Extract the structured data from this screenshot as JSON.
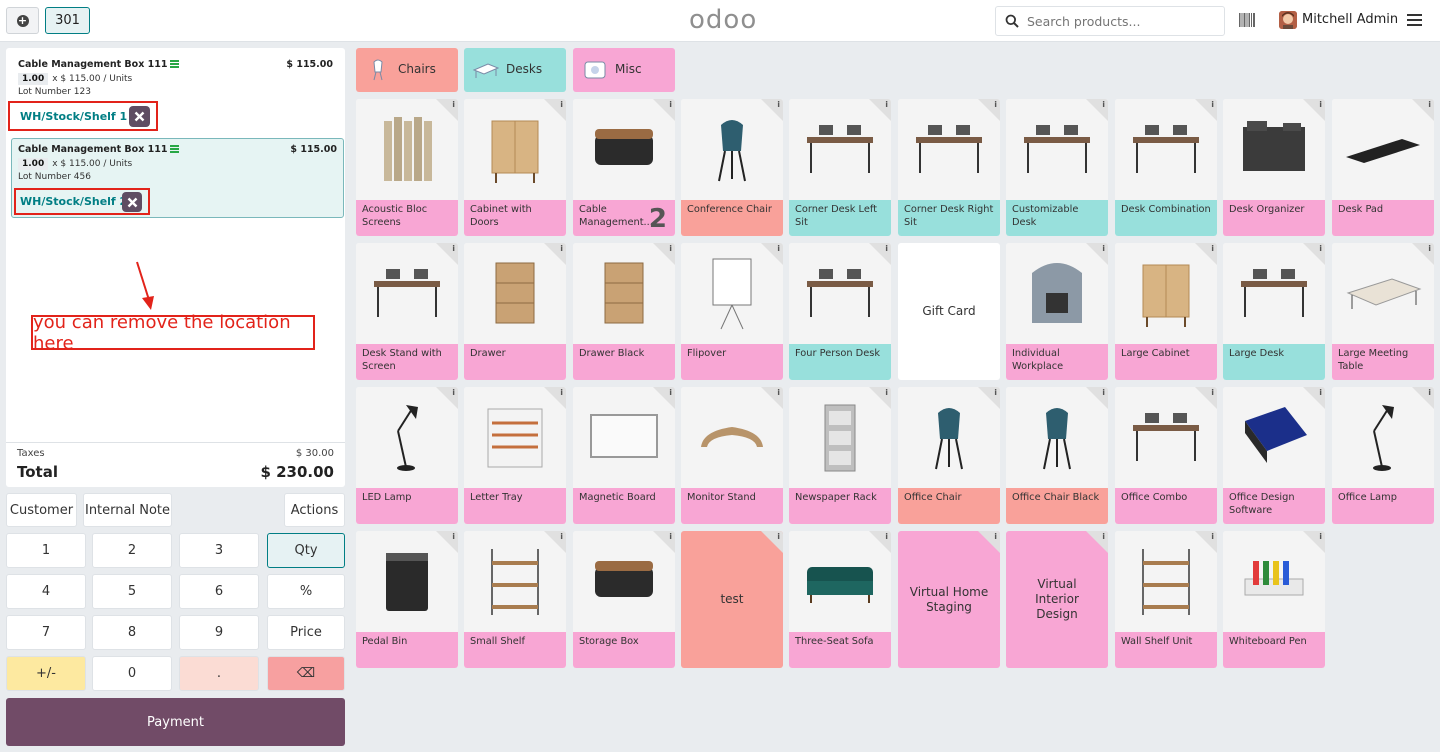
{
  "header": {
    "order_number": "301",
    "logo": "odoo",
    "search_placeholder": "Search products...",
    "user_name": "Mitchell Admin"
  },
  "order": {
    "lines": [
      {
        "name": "Cable Management Box 111",
        "price": "$ 115.00",
        "qty": "1.00",
        "unit_price": "x $ 115.00 / Units",
        "lot": "Lot Number 123",
        "location": "WH/Stock/Shelf 1",
        "selected": false
      },
      {
        "name": "Cable Management Box 111",
        "price": "$ 115.00",
        "qty": "1.00",
        "unit_price": "x $ 115.00 / Units",
        "lot": "Lot Number 456",
        "location": "WH/Stock/Shelf 2",
        "selected": true
      }
    ],
    "annotation": "you can remove the location here",
    "taxes_label": "Taxes",
    "taxes_value": "$ 30.00",
    "total_label": "Total",
    "total_value": "$ 230.00"
  },
  "controls": {
    "customer": "Customer",
    "internal_note": "Internal Note",
    "actions": "Actions"
  },
  "numpad": {
    "keys": [
      "1",
      "2",
      "3",
      "Qty",
      "4",
      "5",
      "6",
      "%",
      "7",
      "8",
      "9",
      "Price",
      "+/-",
      "0",
      ".",
      "⌫"
    ],
    "active": "Qty"
  },
  "payment_label": "Payment",
  "categories": [
    {
      "label": "Chairs",
      "color": "#f9a19a",
      "icon": "chair-icon"
    },
    {
      "label": "Desks",
      "color": "#98e0dc",
      "icon": "desk-icon"
    },
    {
      "label": "Misc",
      "color": "#f8a6d4",
      "icon": "misc-icon"
    }
  ],
  "colors": {
    "pink": "#f8a6d4",
    "salmon": "#f9a19a",
    "teal": "#98e0dc",
    "payment": "#714b67",
    "brand": "#017e84",
    "annotation_red": "#e2231a"
  },
  "products": [
    {
      "name": "Acoustic Bloc Screens",
      "color": "pink",
      "icon": "screen-icon"
    },
    {
      "name": "Cabinet with Doors",
      "color": "pink",
      "icon": "cabinet-icon"
    },
    {
      "name": "Cable Management...",
      "color": "pink",
      "icon": "box-icon",
      "badge": "2"
    },
    {
      "name": "Conference Chair",
      "color": "salmon",
      "icon": "chair-icon"
    },
    {
      "name": "Corner Desk Left Sit",
      "color": "teal",
      "icon": "desk-icon"
    },
    {
      "name": "Corner Desk Right Sit",
      "color": "teal",
      "icon": "desk-icon"
    },
    {
      "name": "Customizable Desk",
      "color": "teal",
      "icon": "desk-icon"
    },
    {
      "name": "Desk Combination",
      "color": "teal",
      "icon": "desk-icon"
    },
    {
      "name": "Desk Organizer",
      "color": "pink",
      "icon": "organizer-icon"
    },
    {
      "name": "Desk Pad",
      "color": "pink",
      "icon": "pad-icon"
    },
    {
      "name": "Desk Stand with Screen",
      "color": "pink",
      "icon": "desk-icon"
    },
    {
      "name": "Drawer",
      "color": "pink",
      "icon": "drawer-icon"
    },
    {
      "name": "Drawer Black",
      "color": "pink",
      "icon": "drawer-icon"
    },
    {
      "name": "Flipover",
      "color": "pink",
      "icon": "flipchart-icon"
    },
    {
      "name": "Four Person Desk",
      "color": "teal",
      "icon": "desk-icon"
    },
    {
      "name": "Gift Card",
      "color": "none",
      "textonly": true
    },
    {
      "name": "Individual Workplace",
      "color": "pink",
      "icon": "pod-icon"
    },
    {
      "name": "Large Cabinet",
      "color": "pink",
      "icon": "cabinet-icon"
    },
    {
      "name": "Large Desk",
      "color": "teal",
      "icon": "desk-icon"
    },
    {
      "name": "Large Meeting Table",
      "color": "pink",
      "icon": "table-icon"
    },
    {
      "name": "LED Lamp",
      "color": "pink",
      "icon": "lamp-icon"
    },
    {
      "name": "Letter Tray",
      "color": "pink",
      "icon": "tray-icon"
    },
    {
      "name": "Magnetic Board",
      "color": "pink",
      "icon": "board-icon"
    },
    {
      "name": "Monitor Stand",
      "color": "pink",
      "icon": "stand-icon"
    },
    {
      "name": "Newspaper Rack",
      "color": "pink",
      "icon": "rack-icon"
    },
    {
      "name": "Office Chair",
      "color": "salmon",
      "icon": "chair-icon"
    },
    {
      "name": "Office Chair Black",
      "color": "salmon",
      "icon": "chair-icon"
    },
    {
      "name": "Office Combo",
      "color": "pink",
      "icon": "desk-icon"
    },
    {
      "name": "Office Design Software",
      "color": "pink",
      "icon": "software-icon"
    },
    {
      "name": "Office Lamp",
      "color": "pink",
      "icon": "lamp-icon"
    },
    {
      "name": "Pedal Bin",
      "color": "pink",
      "icon": "bin-icon"
    },
    {
      "name": "Small Shelf",
      "color": "pink",
      "icon": "shelf-icon"
    },
    {
      "name": "Storage Box",
      "color": "pink",
      "icon": "box-icon"
    },
    {
      "name": "test",
      "color": "salmon",
      "textonly": true
    },
    {
      "name": "Three-Seat Sofa",
      "color": "pink",
      "icon": "sofa-icon"
    },
    {
      "name": "Virtual Home Staging",
      "color": "pink",
      "textonly": true
    },
    {
      "name": "Virtual Interior Design",
      "color": "pink",
      "textonly": true
    },
    {
      "name": "Wall Shelf Unit",
      "color": "pink",
      "icon": "shelf-icon"
    },
    {
      "name": "Whiteboard Pen",
      "color": "pink",
      "icon": "pen-icon"
    }
  ]
}
